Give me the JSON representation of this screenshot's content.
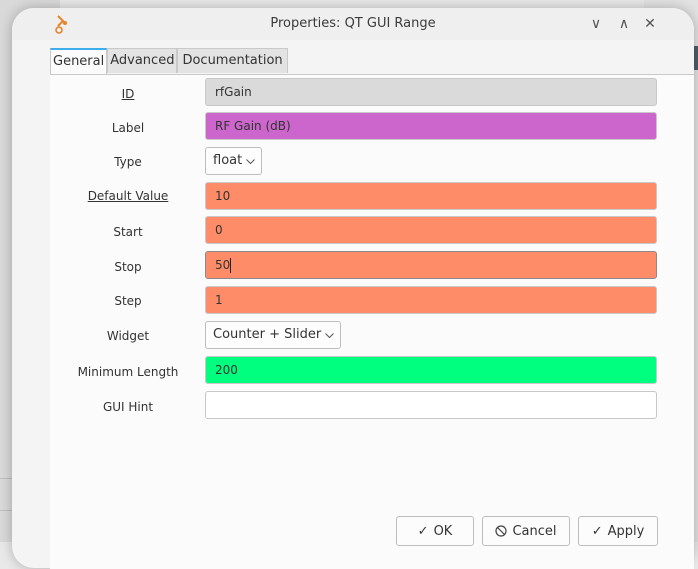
{
  "window": {
    "title": "Properties: QT GUI Range",
    "minimize_glyph": "∨",
    "maximize_glyph": "∧",
    "close_glyph": "✕"
  },
  "tabs": [
    {
      "label": "General",
      "active": true
    },
    {
      "label": "Advanced",
      "active": false
    },
    {
      "label": "Documentation",
      "active": false
    }
  ],
  "fields": {
    "id": {
      "label": "ID",
      "value": "rfGain",
      "color": "#dadada"
    },
    "label": {
      "label": "Label",
      "value": "RF Gain (dB)",
      "color": "#cc66cc"
    },
    "type": {
      "label": "Type",
      "value": "float"
    },
    "default_value": {
      "label": "Default Value",
      "value": "10",
      "color": "#ff8c69"
    },
    "start": {
      "label": "Start",
      "value": "0",
      "color": "#ff8c69"
    },
    "stop": {
      "label": "Stop",
      "value": "50",
      "color": "#ff8c69"
    },
    "step": {
      "label": "Step",
      "value": "1",
      "color": "#ff8c69"
    },
    "widget": {
      "label": "Widget",
      "value": "Counter + Slider"
    },
    "minimum_length": {
      "label": "Minimum Length",
      "value": "200",
      "color": "#00ff7f"
    },
    "gui_hint": {
      "label": "GUI Hint",
      "value": "",
      "color": "#ffffff"
    }
  },
  "buttons": {
    "ok": {
      "label": "OK",
      "icon": "check-icon"
    },
    "cancel": {
      "label": "Cancel",
      "icon": "cancel-icon"
    },
    "apply": {
      "label": "Apply",
      "icon": "check-icon"
    }
  },
  "colors": {
    "accent": "#3daee9"
  }
}
